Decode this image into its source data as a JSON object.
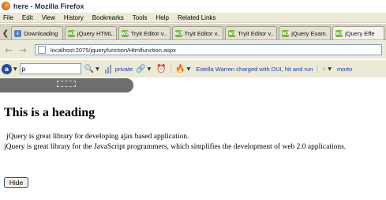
{
  "window": {
    "title": "here - Mozilla Firefox"
  },
  "menubar": {
    "items": [
      "File",
      "Edit",
      "View",
      "History",
      "Bookmarks",
      "Tools",
      "Help",
      "Related Links"
    ]
  },
  "tabs": [
    {
      "label": "Downloading ...",
      "icon": "download-icon",
      "active": false
    },
    {
      "label": "jQuery HTML...",
      "icon": "w3schools-icon",
      "active": false
    },
    {
      "label": "Tryit Editor v...",
      "icon": "w3schools-icon",
      "active": false
    },
    {
      "label": "Tryit Editor v...",
      "icon": "w3schools-icon",
      "active": false
    },
    {
      "label": "Tryit Editor v...",
      "icon": "w3schools-icon",
      "active": false
    },
    {
      "label": "jQuery Exam...",
      "icon": "w3schools-icon",
      "active": false
    },
    {
      "label": "jQuery Effe",
      "icon": "w3schools-icon",
      "active": true
    }
  ],
  "navbar": {
    "url": "localhost:2075/jqueryfunction/Htmlfunction.aspx"
  },
  "searchbar": {
    "query": "p",
    "link_private": "private",
    "news_link": "Estella Warren charged with DUI, hit and run",
    "trailing_link": "morto"
  },
  "page": {
    "heading": "This is a heading",
    "paragraph1": "jQuery is great library for developing ajax based application.",
    "paragraph2": "jQuery is great library for the JavaScript programmers, which simplifies the development of web 2.0 applications.",
    "hide_button": "Hide"
  }
}
